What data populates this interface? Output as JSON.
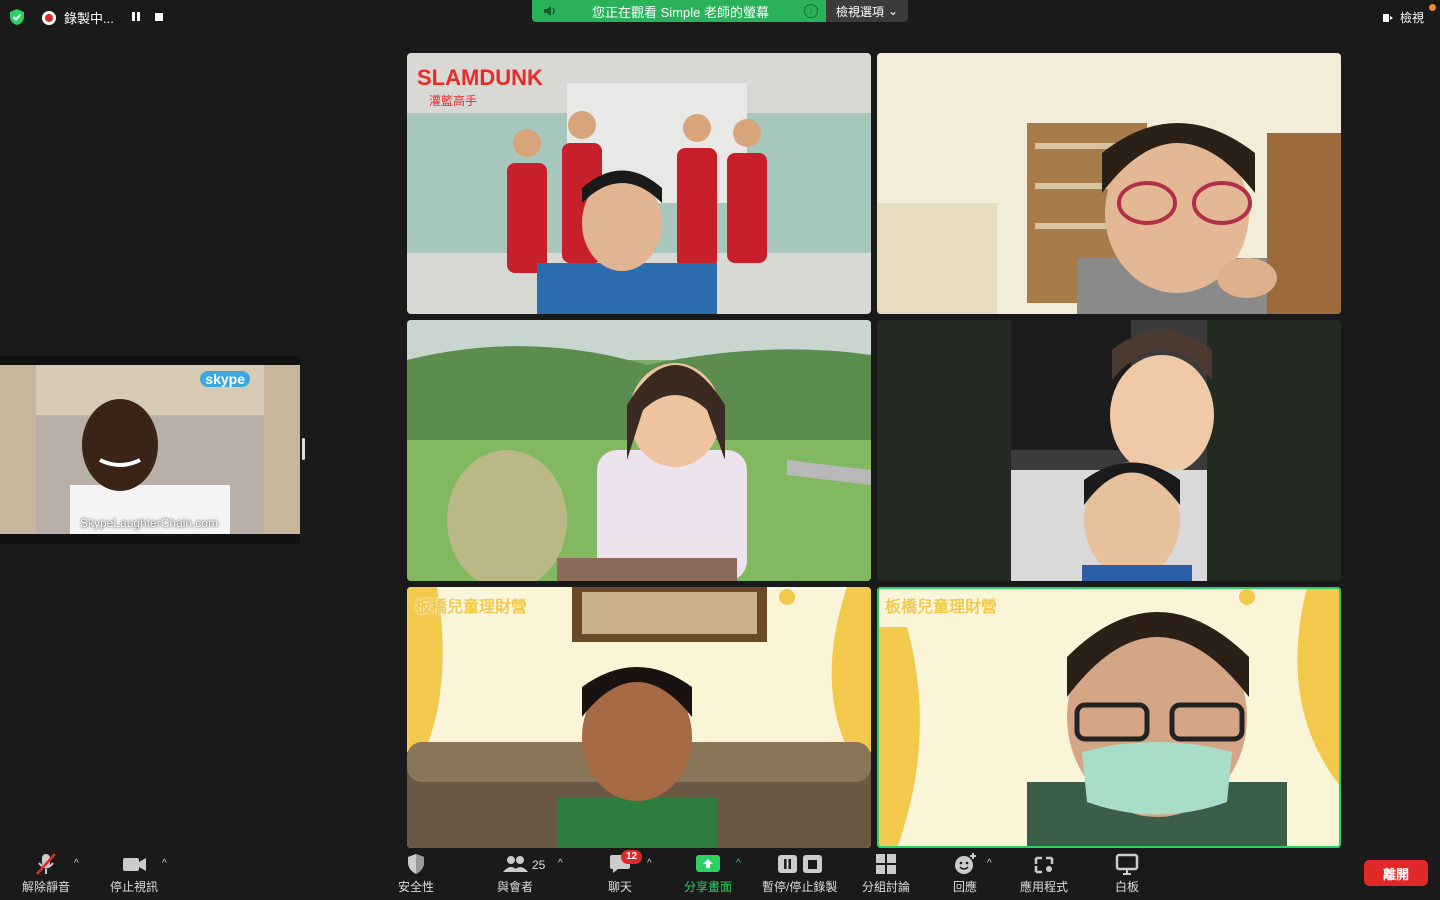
{
  "topbar": {
    "recording_label": "錄製中...",
    "share_banner": "您正在觀看 Simple 老師的螢幕",
    "view_options": "檢視選項",
    "view_right": "檢視"
  },
  "tiles": [
    {
      "caption": ""
    },
    {
      "caption": ""
    },
    {
      "caption": ""
    },
    {
      "caption": ""
    },
    {
      "caption": "板橋兒童理財營"
    },
    {
      "caption": "板橋兒童理財營"
    }
  ],
  "slamdunk": {
    "title": "SLAMDUNK",
    "subtitle": "灌籃高手"
  },
  "self_view": {
    "skype_logo": "skype",
    "caption": "SkypeLaughterChain.com"
  },
  "toolbar": {
    "unmute": "解除靜音",
    "stop_video": "停止視訊",
    "security": "安全性",
    "participants": "與會者",
    "participants_count": "25",
    "chat": "聊天",
    "chat_badge": "12",
    "share_screen": "分享畫面",
    "pause_stop_recording": "暫停/停止錄製",
    "breakout": "分組討論",
    "reactions": "回應",
    "apps": "應用程式",
    "whiteboard": "白板",
    "leave": "離開"
  },
  "colors": {
    "accent_green": "#2bd162",
    "leave_red": "#e02828",
    "banner_green": "#2ab25b"
  }
}
